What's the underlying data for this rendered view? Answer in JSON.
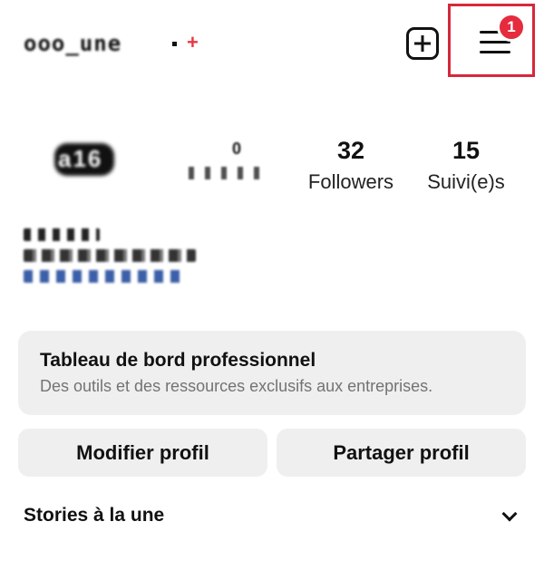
{
  "header": {
    "username": "ooo_une",
    "create_icon": "plus-square-icon",
    "menu_icon": "hamburger-menu-icon",
    "notification_count": "1",
    "highlight_color": "#d6283b"
  },
  "profile": {
    "avatar_text": "a16",
    "stats": {
      "followers_value": "32",
      "followers_label": "Followers",
      "following_value": "15",
      "following_label": "Suivi(e)s"
    }
  },
  "pro_dashboard": {
    "title": "Tableau de bord professionnel",
    "subtitle": "Des outils et des ressources exclusifs aux entreprises."
  },
  "actions": {
    "edit_label": "Modifier profil",
    "share_label": "Partager profil"
  },
  "highlights": {
    "title": "Stories à la une",
    "toggle_icon": "chevron-down-icon"
  },
  "colors": {
    "badge": "#e52b3d",
    "button_bg": "#efefef",
    "muted_text": "#737373"
  }
}
